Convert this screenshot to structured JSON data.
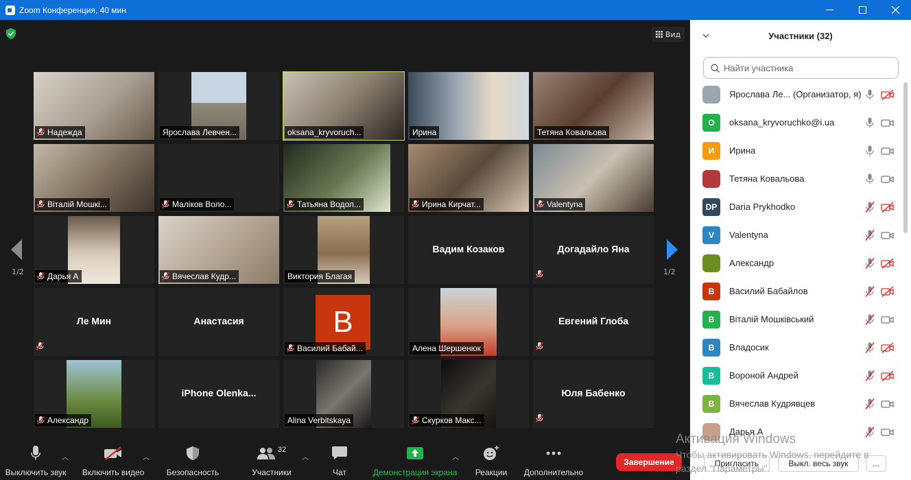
{
  "window": {
    "title": "Zoom Конференция, 40 мин"
  },
  "view_button": {
    "label": "Вид"
  },
  "pages": {
    "left": "1/2",
    "right": "1/2"
  },
  "tiles": [
    {
      "name": "Надежда",
      "muted": true
    },
    {
      "name": "Ярослава Левчен...",
      "muted": false
    },
    {
      "name": "oksana_kryvoruch...",
      "muted": false,
      "active": true
    },
    {
      "name": "Ирина",
      "muted": false
    },
    {
      "name": "Тетяна Ковальова",
      "muted": false
    },
    {
      "name": "Віталій Мошкі...",
      "muted": true
    },
    {
      "name": "Маліков Воло...",
      "muted": true
    },
    {
      "name": "Татьяна Водол...",
      "muted": true
    },
    {
      "name": "Ирина Кирчат...",
      "muted": true
    },
    {
      "name": "Valentyna",
      "muted": true
    },
    {
      "name": "Дарья А",
      "muted": true
    },
    {
      "name": "Вячеслав Кудр...",
      "muted": true
    },
    {
      "name": "Виктория Благая",
      "muted": false
    },
    {
      "center": "Вадим Козаков",
      "muted": false
    },
    {
      "center": "Догадайло Яна",
      "muted": true
    },
    {
      "center": "Ле Мин",
      "muted": true
    },
    {
      "center": "Анастасия",
      "muted": false
    },
    {
      "name": "Василий Бабай...",
      "muted": true,
      "avatar_letter": "В"
    },
    {
      "name": "Алена Шершенюк",
      "muted": false
    },
    {
      "center": "Евгений Глоба",
      "muted": true
    },
    {
      "name": "Александр",
      "muted": true
    },
    {
      "center": "iPhone  Olenka...",
      "muted": false
    },
    {
      "name": "Alina Verbitskaya",
      "muted": false
    },
    {
      "name": "Скурков Макс...",
      "muted": true
    },
    {
      "center": "Юля Бабенко",
      "muted": true
    }
  ],
  "toolbar": {
    "mute": "Выключить звук",
    "video": "Включить видео",
    "security": "Безопасность",
    "participants": "Участники",
    "participants_count": "32",
    "chat": "Чат",
    "share": "Демонстрация экрана",
    "reactions": "Реакции",
    "more": "Дополнительно",
    "end": "Завершение"
  },
  "panel": {
    "title": "Участники (32)",
    "search_placeholder": "Найти участника",
    "participants": [
      {
        "name": "Ярослава Ле...",
        "role": "(Организатор, я)",
        "initials": "",
        "color": "#9aa6b0",
        "mic": "on",
        "cam": "off"
      },
      {
        "name": "oksana_kryvoruchko@i.ua",
        "initials": "O",
        "color": "#23b14d",
        "mic": "on",
        "cam": "on"
      },
      {
        "name": "Ирина",
        "initials": "И",
        "color": "#f39c12",
        "mic": "on",
        "cam": "on"
      },
      {
        "name": "Тетяна Ковальова",
        "initials": "",
        "color": "#b33a3a",
        "mic": "on",
        "cam": "on"
      },
      {
        "name": "Daria Prykhodko",
        "initials": "DP",
        "color": "#34495e",
        "mic": "off",
        "cam": "off"
      },
      {
        "name": "Valentyna",
        "initials": "V",
        "color": "#2e86c1",
        "mic": "off",
        "cam": "on"
      },
      {
        "name": "Александр",
        "initials": "",
        "color": "#6b8e23",
        "mic": "off",
        "cam": "off"
      },
      {
        "name": "Василий Бабайлов",
        "initials": "В",
        "color": "#c9360e",
        "mic": "off",
        "cam": "off"
      },
      {
        "name": "Віталій Мошківський",
        "initials": "В",
        "color": "#23b14d",
        "mic": "off",
        "cam": "on"
      },
      {
        "name": "Владосик",
        "initials": "В",
        "color": "#2e86c1",
        "mic": "off",
        "cam": "off"
      },
      {
        "name": "Вороной Андрей",
        "initials": "В",
        "color": "#1abc9c",
        "mic": "off",
        "cam": "off"
      },
      {
        "name": "Вячеслав Кудрявцев",
        "initials": "В",
        "color": "#7cb342",
        "mic": "off",
        "cam": "on"
      },
      {
        "name": "Дарья А",
        "initials": "",
        "color": "#c7a08a",
        "mic": "off",
        "cam": "on"
      }
    ],
    "invite": "Пригласить",
    "mute_all": "Выкл. весь звук",
    "more": "..."
  },
  "watermark": {
    "line1": "Активация Windows",
    "line2": "Чтобы активировать Windows, перейдите в",
    "line3": "раздел \"Параметры\"."
  }
}
